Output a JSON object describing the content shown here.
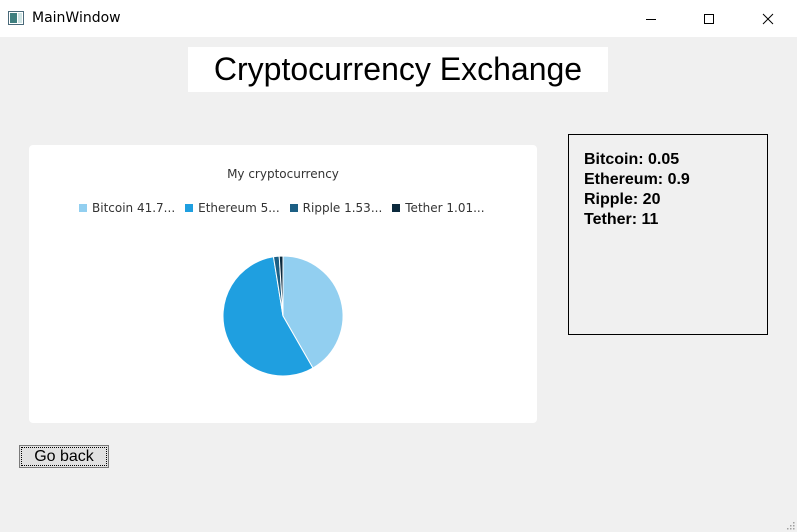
{
  "window": {
    "title": "MainWindow"
  },
  "header": {
    "title": "Cryptocurrency Exchange"
  },
  "chart_data": {
    "type": "pie",
    "title": "My cryptocurrency",
    "legend_placement": "top",
    "slices": [
      {
        "label": "Bitcoin 41.7...",
        "name": "Bitcoin",
        "percent": 41.7,
        "color": "#92cff0"
      },
      {
        "label": "Ethereum 5...",
        "name": "Ethereum",
        "percent": 55.76,
        "color": "#1f9fe0"
      },
      {
        "label": "Ripple 1.53...",
        "name": "Ripple",
        "percent": 1.53,
        "color": "#1c5f84"
      },
      {
        "label": "Tether 1.01...",
        "name": "Tether",
        "percent": 1.01,
        "color": "#0c2a3d"
      }
    ]
  },
  "balances": [
    {
      "text": "Bitcoin: 0.05"
    },
    {
      "text": "Ethereum: 0.9"
    },
    {
      "text": "Ripple: 20"
    },
    {
      "text": "Tether: 11"
    }
  ],
  "buttons": {
    "go_back_label": "Go back"
  },
  "colors": {
    "window_bg": "#f0f0f0",
    "panel_bg": "#ffffff"
  }
}
